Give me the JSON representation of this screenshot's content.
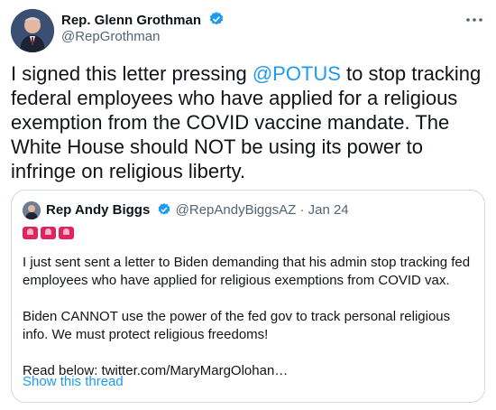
{
  "author": {
    "name": "Rep. Glenn Grothman",
    "handle": "@RepGrothman",
    "verified": true
  },
  "tweet": {
    "text_before": "I signed this letter pressing ",
    "mention": "@POTUS",
    "text_after": " to stop tracking federal employees who have applied for a religious exemption from the COVID vaccine mandate. The White House should NOT be using its power to infringe on religious liberty."
  },
  "quote": {
    "name": "Rep Andy Biggs",
    "handle": "@RepAndyBiggsAZ",
    "separator": "·",
    "date": "Jan 24",
    "emojis": [
      "siren",
      "siren",
      "siren"
    ],
    "paragraph1": "I just sent sent a letter to Biden demanding that his admin stop tracking fed employees who have applied for religious exemptions from COVID vax.",
    "paragraph2": "Biden CANNOT use the power of the fed gov to track personal religious info. We must protect religious freedoms!",
    "paragraph3": "Read below: twitter.com/MaryMargOlohan…",
    "show_thread": "Show this thread"
  },
  "colors": {
    "accent": "#1d9bf0",
    "text": "#0f1419",
    "secondary": "#536471",
    "border": "#cfd9de"
  },
  "icons": {
    "verified": "verified-badge-icon",
    "more": "more-options-icon"
  }
}
